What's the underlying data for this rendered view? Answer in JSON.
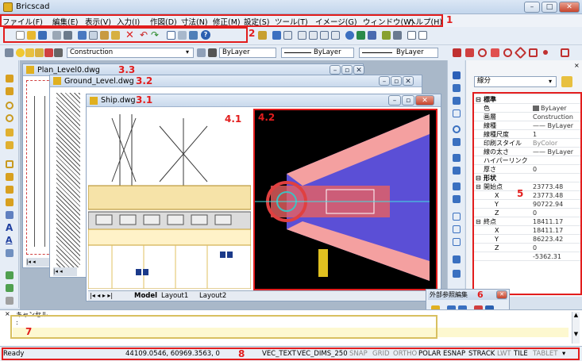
{
  "app": {
    "title": "Bricscad"
  },
  "menu": [
    "ファイル(F)",
    "編集(E)",
    "表示(V)",
    "入力(I)",
    "作図(D)",
    "寸法(N)",
    "修正(M)",
    "設定(S)",
    "ツール(T)",
    "イメージ(G)",
    "ウィンドウ(W)",
    "ヘルプ(H)"
  ],
  "annotations": {
    "n1": "1",
    "n2": "2",
    "n3_1": "3.1",
    "n3_2": "3.2",
    "n3_3": "3.3",
    "n4_1": "4.1",
    "n4_2": "4.2",
    "n5": "5",
    "n6": "6",
    "n7": "7",
    "n8": "8"
  },
  "layer_toolbar": {
    "layer": "Construction",
    "color": "ByLayer",
    "linetype": "ByLayer",
    "lineweight": "ByLayer"
  },
  "documents": {
    "plan": "Plan_Level0.dwg",
    "ground": "Ground_Level.dwg",
    "ship": "Ship.dwg"
  },
  "layout_tabs": [
    "Model",
    "Layout1",
    "Layout2"
  ],
  "properties": {
    "selector": "線分",
    "sections": [
      {
        "type": "hdr",
        "label": "標準"
      },
      {
        "label": "色",
        "value": "ByLayer"
      },
      {
        "label": "画層",
        "value": "Construction"
      },
      {
        "label": "線種",
        "value": "—— ByLayer"
      },
      {
        "label": "線種尺度",
        "value": "1"
      },
      {
        "label": "印刷スタイル",
        "value": "ByColor"
      },
      {
        "label": "線の太さ",
        "value": "—— ByLayer"
      },
      {
        "label": "ハイパーリンク",
        "value": ""
      },
      {
        "label": "厚さ",
        "value": "0"
      },
      {
        "type": "hdr",
        "label": "形状"
      },
      {
        "type": "sub",
        "label": "開始点",
        "value": "23773.48"
      },
      {
        "label": "X",
        "value": "23773.48"
      },
      {
        "label": "Y",
        "value": "90722.94"
      },
      {
        "label": "Z",
        "value": "0"
      },
      {
        "type": "sub",
        "label": "終点",
        "value": "18411.17"
      },
      {
        "label": "X",
        "value": "18411.17"
      },
      {
        "label": "Y",
        "value": "86223.42"
      },
      {
        "label": "Z",
        "value": "0"
      },
      {
        "label": "",
        "value": "-5362.31"
      }
    ]
  },
  "xref_panel": {
    "title": "外部参照編集"
  },
  "command": {
    "line1": "キャンセル",
    "line2": ":",
    "line3": ":"
  },
  "status": {
    "ready": "Ready",
    "coords": "44109.0546, 60969.3563, 0",
    "items": [
      {
        "label": "VEC_TEXT",
        "on": true
      },
      {
        "label": "VEC_DIMS_250",
        "on": true
      },
      {
        "label": "SNAP",
        "on": false
      },
      {
        "label": "GRID",
        "on": false
      },
      {
        "label": "ORTHO",
        "on": false
      },
      {
        "label": "POLAR",
        "on": true
      },
      {
        "label": "ESNAP",
        "on": true
      },
      {
        "label": "STRACK",
        "on": true
      },
      {
        "label": "LWT",
        "on": false
      },
      {
        "label": "TILE",
        "on": true
      },
      {
        "label": "TABLET",
        "on": false
      }
    ]
  }
}
